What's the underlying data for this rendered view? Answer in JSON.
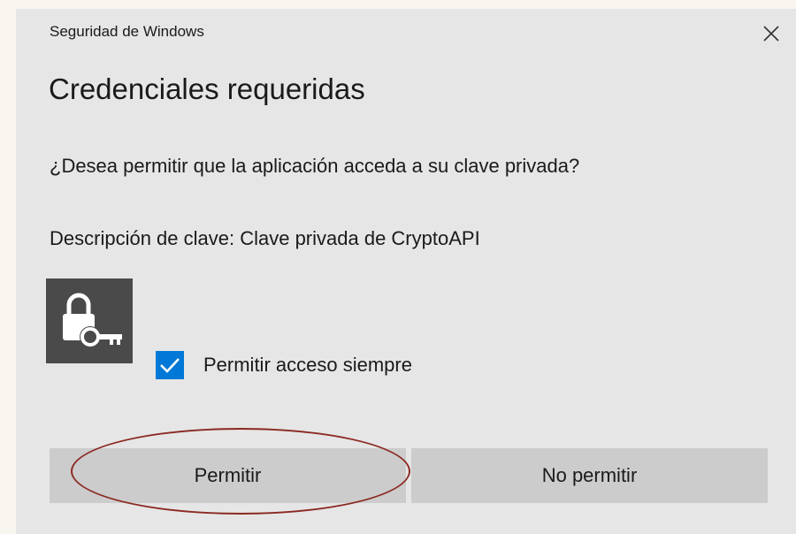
{
  "window": {
    "title": "Seguridad de Windows",
    "close_icon": "close-icon"
  },
  "dialog": {
    "heading": "Credenciales requeridas",
    "question": "¿Desea permitir que la aplicación acceda a su clave privada?",
    "description": "Descripción de clave: Clave privada de CryptoAPI",
    "icon": "lock-key-icon"
  },
  "checkbox": {
    "label": "Permitir acceso siempre",
    "checked": true
  },
  "buttons": {
    "allow": "Permitir",
    "deny": "No permitir"
  },
  "colors": {
    "dialog_bg": "#e6e6e6",
    "accent": "#0078d7",
    "button_bg": "#cccccc",
    "icon_tile": "#4a4a4a",
    "annotation": "#8b2a22"
  }
}
